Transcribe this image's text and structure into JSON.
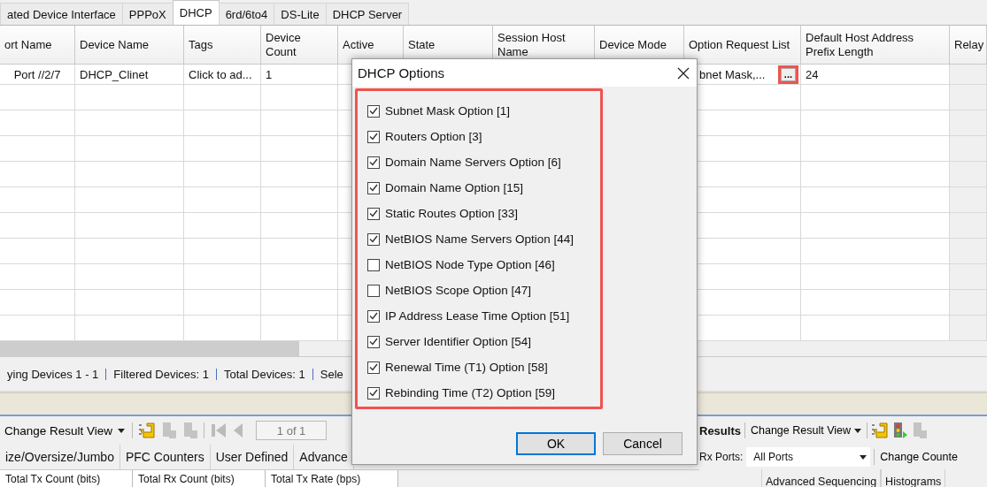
{
  "tabs": [
    {
      "label": "ated Device Interface",
      "selected": false
    },
    {
      "label": "PPPoX",
      "selected": false
    },
    {
      "label": "DHCP",
      "selected": true
    },
    {
      "label": "6rd/6to4",
      "selected": false
    },
    {
      "label": "DS-Lite",
      "selected": false
    },
    {
      "label": "DHCP Server",
      "selected": false
    }
  ],
  "grid": {
    "columns": [
      "ort Name",
      "Device Name",
      "Tags",
      "Device Count",
      "Active",
      "State",
      "Session Host Name",
      "Device Mode",
      "Option Request List",
      "Default Host Address Prefix Length",
      "Relay"
    ],
    "row": {
      "port_name": "Port //2/7",
      "device_name": "DHCP_Clinet",
      "tags": "Click to ad...",
      "device_count": "1",
      "option_request_list": "bnet Mask,...",
      "option_button": "...",
      "prefix_length": "24"
    }
  },
  "status_bar": [
    "ying Devices 1 - 1",
    "Filtered Devices: 1",
    "Total Devices: 1",
    "Sele"
  ],
  "results_left": {
    "view_menu": "Change Result View",
    "page": "1 of 1",
    "tabs": [
      {
        "label": "ize/Oversize/Jumbo",
        "selected": false
      },
      {
        "label": "PFC Counters",
        "selected": false
      },
      {
        "label": "User Defined",
        "selected": false
      },
      {
        "label": "Advance",
        "selected": false
      }
    ],
    "columns": [
      "Total Tx Count (bits)",
      "Total Rx Count (bits)",
      "Total Tx Rate (bps)"
    ]
  },
  "results_right": {
    "title": "Results",
    "view_menu": "Change Result View",
    "rx_ports_label": "Rx Ports:",
    "rx_ports_value": "All Ports",
    "counter_menu": "Change Counte",
    "tabs": [
      {
        "label": "Advanced Sequencing",
        "selected": false
      },
      {
        "label": "Histograms",
        "selected": false
      }
    ]
  },
  "dialog": {
    "title": "DHCP Options",
    "options": [
      {
        "label": "Subnet Mask Option [1]",
        "checked": true
      },
      {
        "label": "Routers Option [3]",
        "checked": true
      },
      {
        "label": "Domain Name Servers Option [6]",
        "checked": true
      },
      {
        "label": "Domain Name Option [15]",
        "checked": true
      },
      {
        "label": "Static Routes Option [33]",
        "checked": true
      },
      {
        "label": "NetBIOS Name Servers Option [44]",
        "checked": true
      },
      {
        "label": "NetBIOS Node Type Option [46]",
        "checked": false
      },
      {
        "label": "NetBIOS Scope Option [47]",
        "checked": false
      },
      {
        "label": "IP Address Lease Time Option [51]",
        "checked": true
      },
      {
        "label": "Server Identifier Option [54]",
        "checked": true
      },
      {
        "label": "Renewal Time (T1) Option [58]",
        "checked": true
      },
      {
        "label": "Rebinding Time (T2) Option [59]",
        "checked": true
      }
    ],
    "buttons": [
      {
        "label": "OK",
        "selected": true
      },
      {
        "label": "Cancel",
        "selected": false
      }
    ]
  }
}
